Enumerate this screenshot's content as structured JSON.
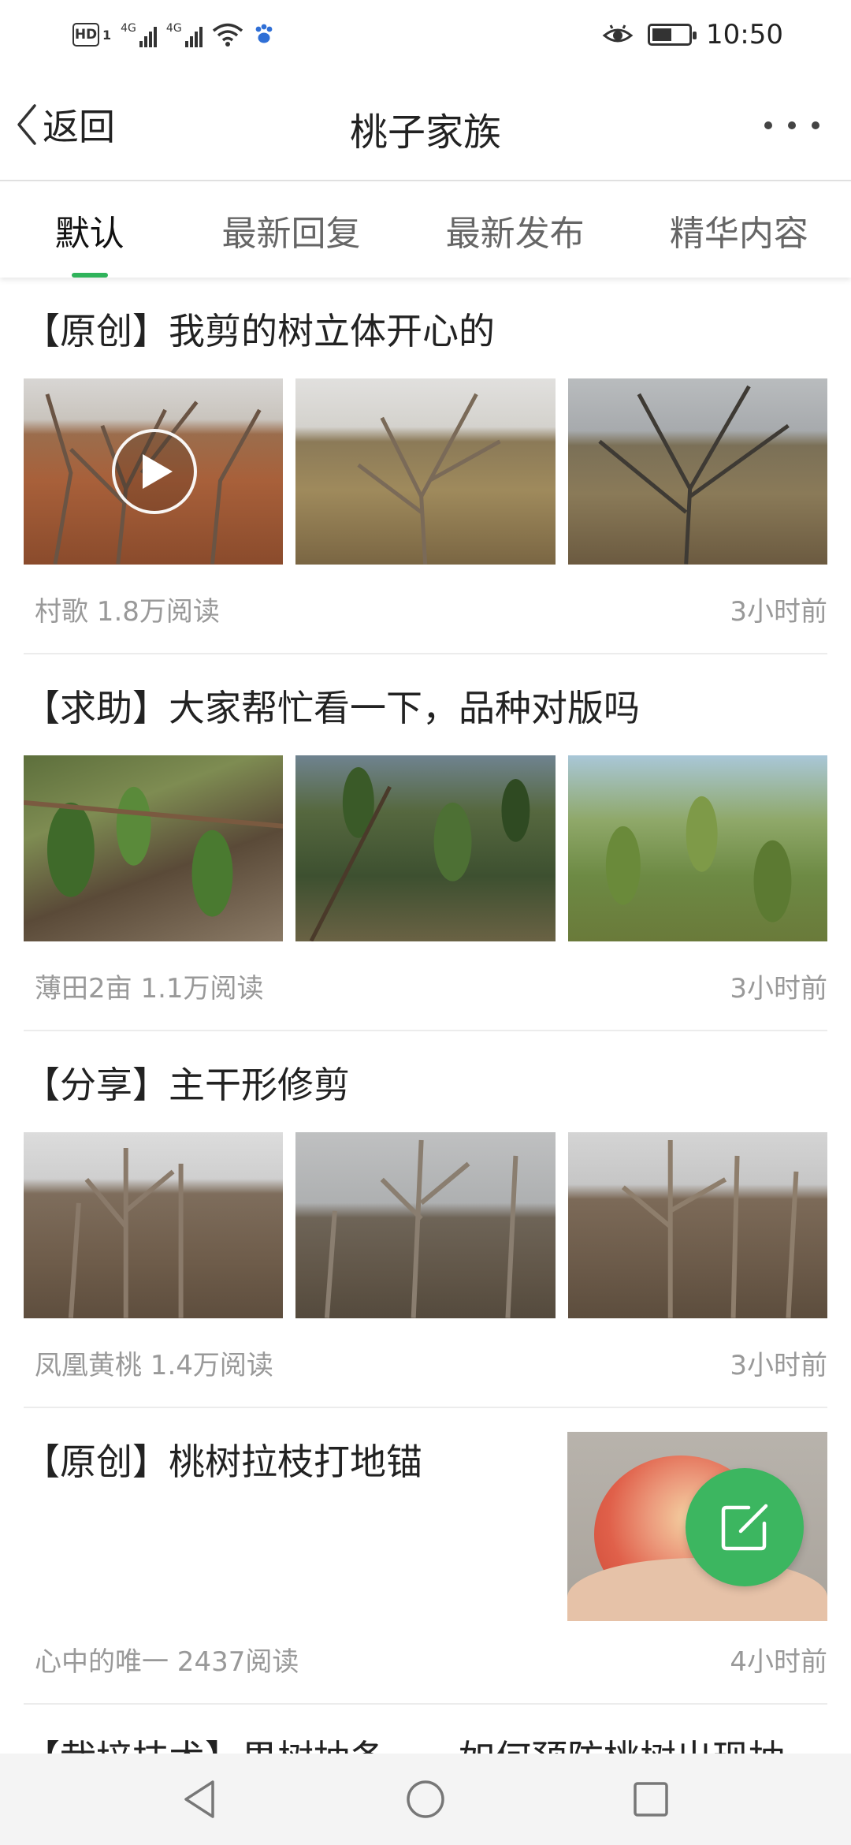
{
  "status_bar": {
    "hd_label": "HD",
    "hd_sub": "1",
    "network_1": "4G",
    "network_2": "4G",
    "time": "10:50",
    "battery_level": 0.55
  },
  "header": {
    "back_label": "返回",
    "title": "桃子家族"
  },
  "tabs": [
    {
      "label": "默认",
      "active": true
    },
    {
      "label": "最新回复",
      "active": false
    },
    {
      "label": "最新发布",
      "active": false
    },
    {
      "label": "精华内容",
      "active": false
    }
  ],
  "posts": [
    {
      "title": "【原创】我剪的树立体开心的",
      "author_reads": "村歌 1.8万阅读",
      "time": "3小时前",
      "has_video": true
    },
    {
      "title": "【求助】大家帮忙看一下，品种对版吗",
      "author_reads": "薄田2亩 1.1万阅读",
      "time": "3小时前"
    },
    {
      "title": "【分享】主干形修剪",
      "author_reads": "凤凰黄桃 1.4万阅读",
      "time": "3小时前"
    },
    {
      "title": "【原创】桃树拉枝打地锚",
      "author_reads": "心中的唯一 2437阅读",
      "time": "4小时前"
    },
    {
      "title": "【栽培技术】果树抽条——如何预防桃树出现抽"
    }
  ],
  "icons": {
    "back": "chevron-left-icon",
    "more": "more-dots-icon",
    "play": "play-icon",
    "compose": "compose-icon",
    "nav_back": "triangle-back-icon",
    "nav_home": "circle-home-icon",
    "nav_recent": "square-recent-icon"
  },
  "colors": {
    "accent": "#2fb35b",
    "fab": "#3cb660",
    "meta_text": "#999999"
  }
}
